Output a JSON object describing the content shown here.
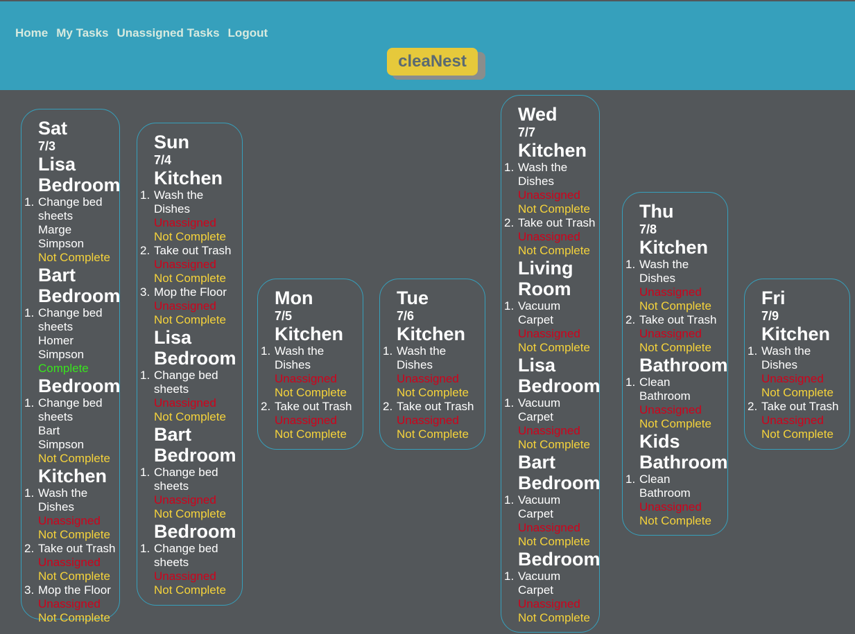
{
  "nav": {
    "home": "Home",
    "my_tasks": "My Tasks",
    "unassigned_tasks": "Unassigned Tasks",
    "logout": "Logout"
  },
  "brand": {
    "name": "cleaNest"
  },
  "colors": {
    "header": "#36a0bc",
    "background": "#53575a",
    "logo": "#e6c93b",
    "unassigned": "#d0021b",
    "not_complete": "#f5d33b",
    "complete": "#39e51d"
  },
  "days": [
    {
      "name": "Sat",
      "date": "7/3",
      "rooms": [
        {
          "name": "Lisa Bedroom",
          "tasks": [
            {
              "n": "1.",
              "lines": [
                "Change bed",
                "sheets"
              ],
              "who": "Marge Simpson",
              "status": "Not Complete"
            }
          ]
        },
        {
          "name": "Bart Bedroom",
          "tasks": [
            {
              "n": "1.",
              "lines": [
                "Change bed",
                "sheets"
              ],
              "who": "Homer Simpson",
              "status": "Complete"
            }
          ]
        },
        {
          "name": "Bedroom",
          "tasks": [
            {
              "n": "1.",
              "lines": [
                "Change bed",
                "sheets"
              ],
              "who": "Bart Simpson",
              "status": "Not Complete"
            }
          ]
        },
        {
          "name": "Kitchen",
          "tasks": [
            {
              "n": "1.",
              "lines": [
                "Wash the",
                "Dishes"
              ],
              "who": "Unassigned",
              "status": "Not Complete"
            },
            {
              "n": "2.",
              "lines": [
                "Take out Trash"
              ],
              "who": "Unassigned",
              "status": "Not Complete"
            },
            {
              "n": "3.",
              "lines": [
                "Mop the Floor"
              ],
              "who": "Unassigned",
              "status": "Not Complete"
            }
          ]
        }
      ]
    },
    {
      "name": "Sun",
      "date": "7/4",
      "rooms": [
        {
          "name": "Kitchen",
          "tasks": [
            {
              "n": "1.",
              "lines": [
                "Wash the",
                "Dishes"
              ],
              "who": "Unassigned",
              "status": "Not Complete"
            },
            {
              "n": "2.",
              "lines": [
                "Take out Trash"
              ],
              "who": "Unassigned",
              "status": "Not Complete"
            },
            {
              "n": "3.",
              "lines": [
                "Mop the Floor"
              ],
              "who": "Unassigned",
              "status": "Not Complete"
            }
          ]
        },
        {
          "name": "Lisa Bedroom",
          "tasks": [
            {
              "n": "1.",
              "lines": [
                "Change bed",
                "sheets"
              ],
              "who": "Unassigned",
              "status": "Not Complete"
            }
          ]
        },
        {
          "name": "Bart Bedroom",
          "tasks": [
            {
              "n": "1.",
              "lines": [
                "Change bed",
                "sheets"
              ],
              "who": "Unassigned",
              "status": "Not Complete"
            }
          ]
        },
        {
          "name": "Bedroom",
          "tasks": [
            {
              "n": "1.",
              "lines": [
                "Change bed",
                "sheets"
              ],
              "who": "Unassigned",
              "status": "Not Complete"
            }
          ]
        }
      ]
    },
    {
      "name": "Mon",
      "date": "7/5",
      "rooms": [
        {
          "name": "Kitchen",
          "tasks": [
            {
              "n": "1.",
              "lines": [
                "Wash the",
                "Dishes"
              ],
              "who": "Unassigned",
              "status": "Not Complete"
            },
            {
              "n": "2.",
              "lines": [
                "Take out Trash"
              ],
              "who": "Unassigned",
              "status": "Not Complete"
            }
          ]
        }
      ]
    },
    {
      "name": "Tue",
      "date": "7/6",
      "rooms": [
        {
          "name": "Kitchen",
          "tasks": [
            {
              "n": "1.",
              "lines": [
                "Wash the",
                "Dishes"
              ],
              "who": "Unassigned",
              "status": "Not Complete"
            },
            {
              "n": "2.",
              "lines": [
                "Take out Trash"
              ],
              "who": "Unassigned",
              "status": "Not Complete"
            }
          ]
        }
      ]
    },
    {
      "name": "Wed",
      "date": "7/7",
      "rooms": [
        {
          "name": "Kitchen",
          "tasks": [
            {
              "n": "1.",
              "lines": [
                "Wash the",
                "Dishes"
              ],
              "who": "Unassigned",
              "status": "Not Complete"
            },
            {
              "n": "2.",
              "lines": [
                "Take out Trash"
              ],
              "who": "Unassigned",
              "status": "Not Complete"
            }
          ]
        },
        {
          "name": "Living Room",
          "tasks": [
            {
              "n": "1.",
              "lines": [
                "Vacuum",
                "Carpet"
              ],
              "who": "Unassigned",
              "status": "Not Complete"
            }
          ]
        },
        {
          "name": "Lisa Bedroom",
          "tasks": [
            {
              "n": "1.",
              "lines": [
                "Vacuum",
                "Carpet"
              ],
              "who": "Unassigned",
              "status": "Not Complete"
            }
          ]
        },
        {
          "name": "Bart Bedroom",
          "tasks": [
            {
              "n": "1.",
              "lines": [
                "Vacuum",
                "Carpet"
              ],
              "who": "Unassigned",
              "status": "Not Complete"
            }
          ]
        },
        {
          "name": "Bedroom",
          "tasks": [
            {
              "n": "1.",
              "lines": [
                "Vacuum",
                "Carpet"
              ],
              "who": "Unassigned",
              "status": "Not Complete"
            }
          ]
        }
      ]
    },
    {
      "name": "Thu",
      "date": "7/8",
      "rooms": [
        {
          "name": "Kitchen",
          "tasks": [
            {
              "n": "1.",
              "lines": [
                "Wash the",
                "Dishes"
              ],
              "who": "Unassigned",
              "status": "Not Complete"
            },
            {
              "n": "2.",
              "lines": [
                "Take out Trash"
              ],
              "who": "Unassigned",
              "status": "Not Complete"
            }
          ]
        },
        {
          "name": "Bathroom",
          "tasks": [
            {
              "n": "1.",
              "lines": [
                "Clean",
                "Bathroom"
              ],
              "who": "Unassigned",
              "status": "Not Complete"
            }
          ]
        },
        {
          "name": "Kids Bathroom",
          "tasks": [
            {
              "n": "1.",
              "lines": [
                "Clean",
                "Bathroom"
              ],
              "who": "Unassigned",
              "status": "Not Complete"
            }
          ]
        }
      ]
    },
    {
      "name": "Fri",
      "date": "7/9",
      "rooms": [
        {
          "name": "Kitchen",
          "tasks": [
            {
              "n": "1.",
              "lines": [
                "Wash the",
                "Dishes"
              ],
              "who": "Unassigned",
              "status": "Not Complete"
            },
            {
              "n": "2.",
              "lines": [
                "Take out Trash"
              ],
              "who": "Unassigned",
              "status": "Not Complete"
            }
          ]
        }
      ]
    }
  ]
}
